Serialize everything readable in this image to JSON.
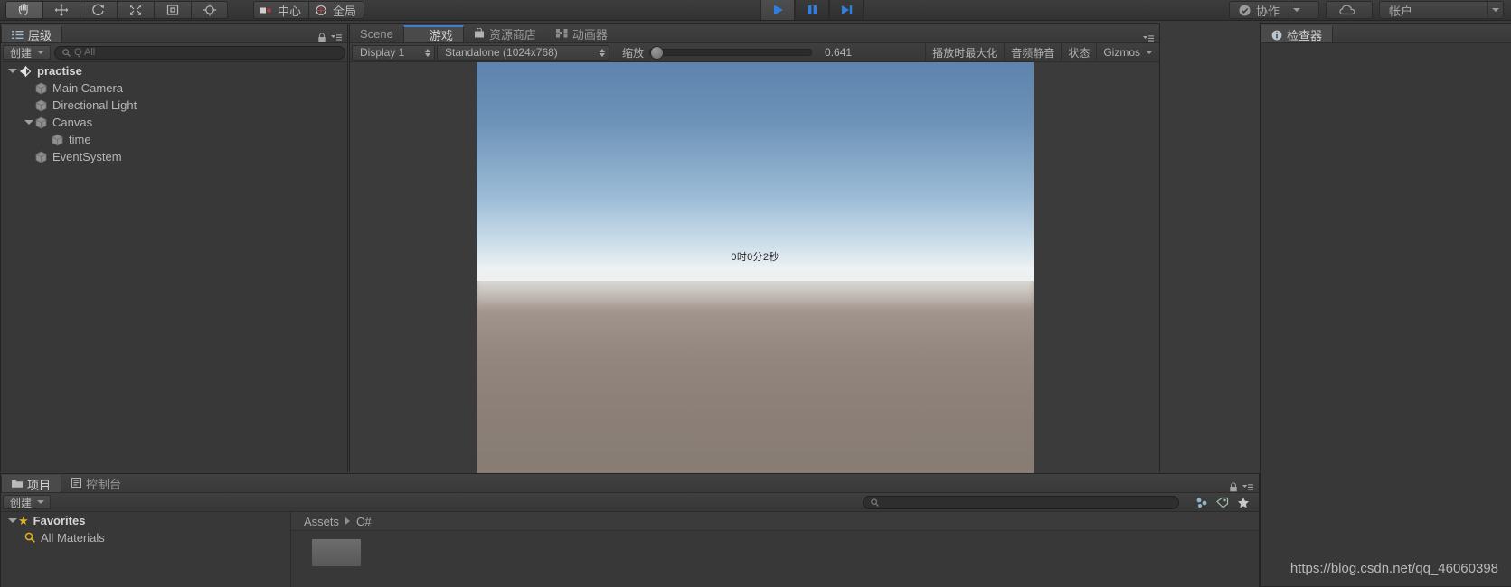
{
  "toolbar": {
    "tools": [
      {
        "name": "hand-tool",
        "active": true
      },
      {
        "name": "move-tool",
        "active": false
      },
      {
        "name": "rotate-tool",
        "active": false
      },
      {
        "name": "scale-tool",
        "active": false
      },
      {
        "name": "rect-tool",
        "active": false
      },
      {
        "name": "transform-tool",
        "active": false
      }
    ],
    "pivot_label": "中心",
    "space_label": "全局",
    "play_label": "play",
    "pause_label": "pause",
    "step_label": "step",
    "collab_label": "协作",
    "cloud_label": "cloud",
    "account_label": "帐户"
  },
  "hierarchy": {
    "tab_label": "层级",
    "create_label": "创建",
    "search_placeholder": "Q All",
    "search_value": "",
    "tree": [
      {
        "label": "practise",
        "depth": 0,
        "expanded": true,
        "type": "scene"
      },
      {
        "label": "Main Camera",
        "depth": 1,
        "expanded": null,
        "type": "object"
      },
      {
        "label": "Directional Light",
        "depth": 1,
        "expanded": null,
        "type": "object"
      },
      {
        "label": "Canvas",
        "depth": 1,
        "expanded": true,
        "type": "object"
      },
      {
        "label": "time",
        "depth": 2,
        "expanded": null,
        "type": "object"
      },
      {
        "label": "EventSystem",
        "depth": 1,
        "expanded": null,
        "type": "object"
      }
    ]
  },
  "gameview": {
    "tabs": [
      {
        "label": "Scene",
        "active": false,
        "icon": "scene-icon"
      },
      {
        "label": "游戏",
        "active": true,
        "icon": "game-icon"
      },
      {
        "label": "资源商店",
        "active": false,
        "icon": "store-icon"
      },
      {
        "label": "动画器",
        "active": false,
        "icon": "animator-icon"
      }
    ],
    "display_label": "Display 1",
    "resolution_label": "Standalone (1024x768)",
    "zoom_label": "缩放",
    "zoom_value": "0.641",
    "toggles": [
      {
        "label": "播放时最大化"
      },
      {
        "label": "音频静音"
      },
      {
        "label": "状态"
      },
      {
        "label": "Gizmos",
        "has_caret": true
      }
    ],
    "overlay_text": "0时0分2秒"
  },
  "inspector": {
    "tab_label": "检查器"
  },
  "project": {
    "tabs": [
      {
        "label": "项目",
        "active": true,
        "icon": "folder-icon"
      },
      {
        "label": "控制台",
        "active": false,
        "icon": "console-icon"
      }
    ],
    "create_label": "创建",
    "search_value": "",
    "favorites_label": "Favorites",
    "favorites_items": [
      "All Materials"
    ],
    "breadcrumb": [
      "Assets",
      "C#"
    ]
  },
  "watermark": "https://blog.csdn.net/qq_46060398",
  "colors": {
    "accent": "#3d7fd1",
    "panel_bg": "#383838",
    "toolbar_bg": "#3b3b3b",
    "star": "#e0b51c"
  }
}
